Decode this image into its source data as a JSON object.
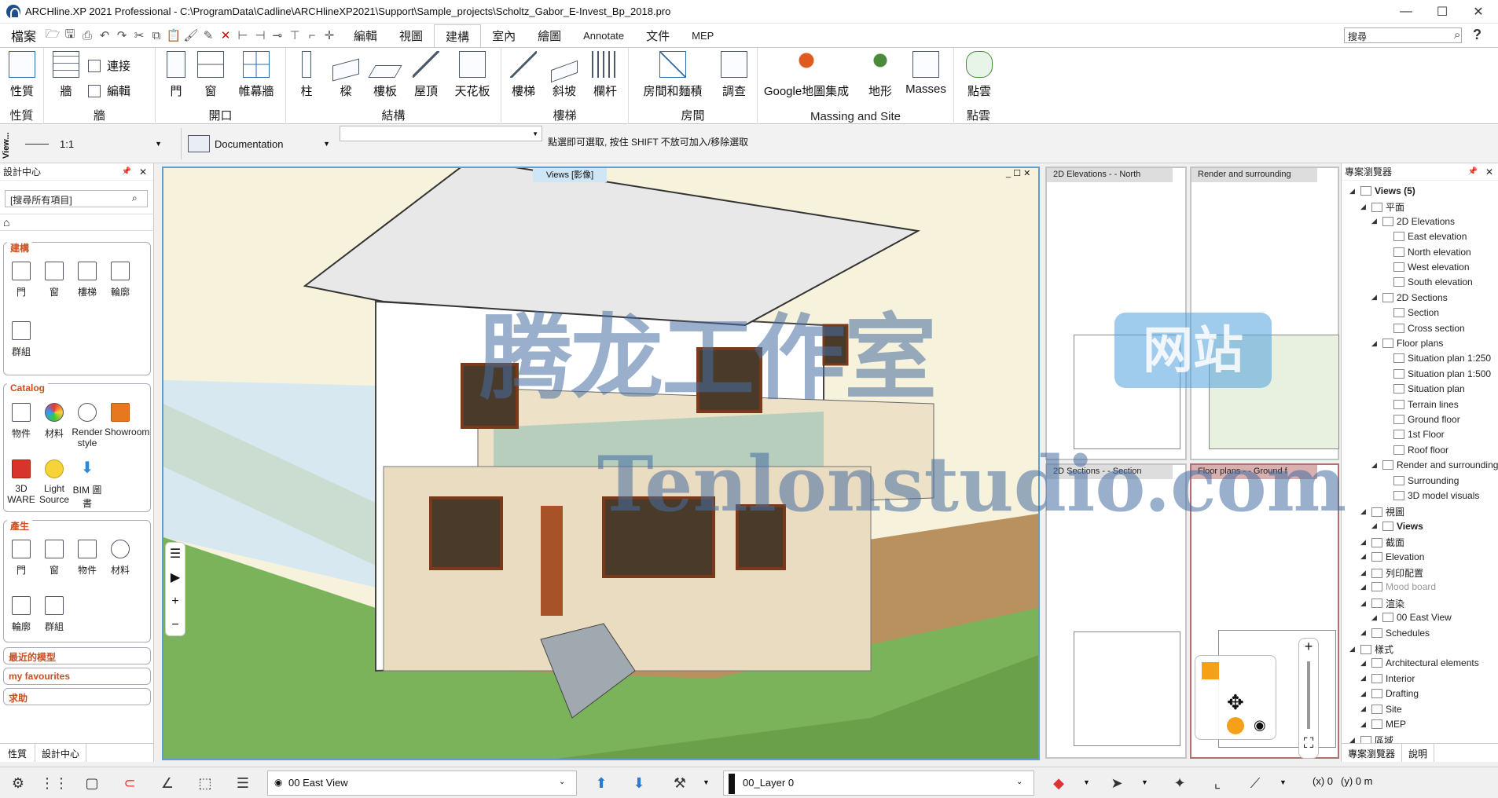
{
  "window": {
    "title": "ARCHline.XP 2021  Professional - C:\\ProgramData\\Cadline\\ARCHlineXP2021\\Support\\Sample_projects\\Scholtz_Gabor_E-Invest_Bp_2018.pro",
    "minimize": "—",
    "maximize": "☐",
    "close": "✕"
  },
  "menubar": {
    "file_menu": "檔案",
    "tabs": [
      "編輯",
      "視圖",
      "建構",
      "室內",
      "繪圖",
      "Annotate",
      "文件",
      "MEP"
    ],
    "search_value": "搜尋",
    "help": "?"
  },
  "ribbon": {
    "groups": {
      "properties": {
        "label": "性質",
        "button": "性質"
      },
      "wall": {
        "label": "牆",
        "button": "牆",
        "connect": "連接",
        "edit": "編輯"
      },
      "opening": {
        "label": "開口",
        "door": "門",
        "window": "窗",
        "curtain": "帷幕牆"
      },
      "structure": {
        "label": "結構",
        "column": "柱",
        "beam": "樑",
        "slab": "樓板",
        "roof": "屋頂",
        "ceiling": "天花板"
      },
      "stairs": {
        "label": "樓梯",
        "stair": "樓梯",
        "ramp": "斜坡",
        "railing": "欄杆"
      },
      "room": {
        "label": "房間",
        "room_area": "房間和麵積",
        "survey": "調查"
      },
      "massing": {
        "label": "Massing and Site",
        "google": "Google地圖集成",
        "terrain": "地形",
        "masses": "Masses"
      },
      "pointcloud": {
        "label": "點雲",
        "button": "點雲"
      }
    }
  },
  "toolbar2": {
    "view_label": "View...",
    "scale": "1:1",
    "style": "Documentation",
    "hint": "點選即可選取, 按住 SHIFT 不放可加入/移除選取"
  },
  "design_center": {
    "title": "設計中心",
    "search_placeholder": "[搜尋所有項目]",
    "sections": {
      "build": {
        "title": "建構",
        "items": [
          "門",
          "窗",
          "樓梯",
          "輪廓",
          "群組"
        ]
      },
      "catalog": {
        "title": "Catalog",
        "items": [
          "物件",
          "材料",
          "Render style",
          "Showroom",
          "3D WARE",
          "Light Source",
          "BIM 圖書"
        ]
      },
      "produce": {
        "title": "產生",
        "items": [
          "門",
          "窗",
          "物件",
          "材料",
          "輪廓",
          "群組"
        ]
      }
    },
    "recent": "最近的模型",
    "favourites": "my favourites",
    "help": "求助",
    "bottom_tabs": [
      "性質",
      "設計中心"
    ]
  },
  "viewport": {
    "title": "Views [影像]"
  },
  "thumbnails": [
    {
      "title": "2D Elevations -  - North"
    },
    {
      "title": "Render and surrounding"
    },
    {
      "title": "2D Sections -  - Section"
    },
    {
      "title": "Floor plans -  - Ground f"
    }
  ],
  "project_browser": {
    "title": "專案瀏覽器",
    "tree": [
      {
        "label": "Views (5)",
        "level": 0,
        "bold": true
      },
      {
        "label": "平面",
        "level": 1
      },
      {
        "label": "2D Elevations",
        "level": 2
      },
      {
        "label": "East elevation",
        "level": 3
      },
      {
        "label": "North elevation",
        "level": 3
      },
      {
        "label": "West elevation",
        "level": 3
      },
      {
        "label": "South elevation",
        "level": 3
      },
      {
        "label": "2D Sections",
        "level": 2
      },
      {
        "label": "Section",
        "level": 3
      },
      {
        "label": "Cross section",
        "level": 3
      },
      {
        "label": "Floor plans",
        "level": 2
      },
      {
        "label": "Situation plan 1:250",
        "level": 3
      },
      {
        "label": "Situation plan 1:500",
        "level": 3
      },
      {
        "label": "Situation plan",
        "level": 3
      },
      {
        "label": "Terrain lines",
        "level": 3
      },
      {
        "label": "Ground floor",
        "level": 3
      },
      {
        "label": "1st Floor",
        "level": 3
      },
      {
        "label": "Roof floor",
        "level": 3
      },
      {
        "label": "Render and surrounding",
        "level": 2
      },
      {
        "label": "Surrounding",
        "level": 3
      },
      {
        "label": "3D model visuals",
        "level": 3
      },
      {
        "label": "視圖",
        "level": 1
      },
      {
        "label": "Views",
        "level": 2,
        "bold": true
      },
      {
        "label": "截面",
        "level": 1
      },
      {
        "label": "Elevation",
        "level": 1
      },
      {
        "label": "列印配置",
        "level": 1
      },
      {
        "label": "Mood board",
        "level": 1,
        "muted": true
      },
      {
        "label": "渲染",
        "level": 1
      },
      {
        "label": "00 East View",
        "level": 2
      },
      {
        "label": "Schedules",
        "level": 1
      },
      {
        "label": "樣式",
        "level": 0
      },
      {
        "label": "Architectural elements",
        "level": 1
      },
      {
        "label": "Interior",
        "level": 1
      },
      {
        "label": "Drafting",
        "level": 1
      },
      {
        "label": "Site",
        "level": 1
      },
      {
        "label": "MEP",
        "level": 1
      },
      {
        "label": "區域",
        "level": 0
      }
    ],
    "bottom_tabs": [
      "專案瀏覽器",
      "說明"
    ]
  },
  "bottombar": {
    "view": "00 East View",
    "layer": "00_Layer 0",
    "coords_x": "(x) 0",
    "coords_y": "(y) 0 m"
  },
  "watermark": {
    "cn": "腾龙工作室",
    "badge": "网站",
    "url": "Tenlonstudio.com"
  }
}
